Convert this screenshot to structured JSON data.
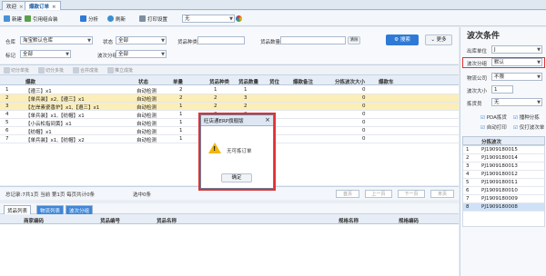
{
  "tabs": [
    {
      "label": "欢迎",
      "active": false
    },
    {
      "label": "爆款订单",
      "active": true
    }
  ],
  "toolbar": {
    "new": "新建",
    "fetch": "引用组合装",
    "analyze": "分析",
    "refresh": "刷新",
    "print_settings": "打印设置",
    "print_select": "无"
  },
  "filter": {
    "warehouse_label": "仓库",
    "warehouse_value": "淘宝默认仓库",
    "status_label": "状态",
    "status_value": "全部",
    "goods_kind_label": "货品种类",
    "goods_count_label": "货品数量",
    "goods_count_btn": "清除",
    "query_btn": "搜索",
    "more_btn": "更多",
    "mark_label": "标记",
    "mark_value": "全部",
    "wave_group_label": "波次分组",
    "wave_group_value": "全部"
  },
  "actions": [
    "切分单批",
    "切分多批",
    "合并成批",
    "推立成批"
  ],
  "grid": {
    "headers": [
      "",
      "爆款",
      "状态",
      "单量",
      "货品种类",
      "货品数量",
      "货位",
      "爆款备注",
      "分拣波次大小",
      "爆款车"
    ],
    "rows": [
      {
        "no": "1",
        "name": "【遵三】x1",
        "status": "自动检测",
        "qty": "2",
        "kinds": "1",
        "count": "1",
        "wave": "0",
        "hl": false
      },
      {
        "no": "2",
        "name": "【单兵装】x2,【遵三】x1",
        "status": "自动检测",
        "qty": "2",
        "kinds": "2",
        "count": "3",
        "wave": "0",
        "hl": true
      },
      {
        "no": "3",
        "name": "【左岸素瓷香炉】x1,【遵三】x1",
        "status": "自动检测",
        "qty": "1",
        "kinds": "2",
        "count": "2",
        "wave": "0",
        "hl": true
      },
      {
        "no": "4",
        "name": "【单兵装】x1,【纺帽】x1",
        "status": "自动检测",
        "qty": "1",
        "kinds": "2",
        "count": "2",
        "wave": "0",
        "hl": false
      },
      {
        "no": "5",
        "name": "【小云松指间黄】x1",
        "status": "自动检测",
        "qty": "1",
        "kinds": "1",
        "count": "1",
        "wave": "0",
        "hl": false
      },
      {
        "no": "6",
        "name": "【纺帽】x1",
        "status": "自动检测",
        "qty": "1",
        "kinds": "1",
        "count": "1",
        "wave": "0",
        "hl": false
      },
      {
        "no": "7",
        "name": "【单兵装】x1,【纺帽】x2",
        "status": "自动检测",
        "qty": "1",
        "kinds": "2",
        "count": "3",
        "wave": "0",
        "hl": false
      }
    ]
  },
  "status": {
    "summary": "总记录:7共1页 当前 第1页 每页共计0条",
    "selected": "选中0条",
    "pager": [
      "首页",
      "上一页",
      "下一页",
      "末页"
    ]
  },
  "bottom_tabs": [
    "货品列表",
    "物流列表",
    "波次分组"
  ],
  "bottom_grid": {
    "headers": [
      "商家编码",
      "货品编号",
      "货品名称",
      "规格名称",
      "规格编码"
    ]
  },
  "dialog": {
    "title": "旺店通ERP旗舰版",
    "message": "无可拣订单",
    "ok": "确定"
  },
  "right": {
    "title": "波次条件",
    "outbound_label": "出库单位",
    "outbound_value": "J",
    "wave_group_label": "波次分组",
    "wave_group_value": "默认",
    "logistics_label": "物流公司",
    "logistics_value": "不限",
    "wave_size_label": "波次大小",
    "wave_size_value": "1",
    "picker_label": "拣货员",
    "picker_value": "无",
    "checks": [
      {
        "label": "PDA拣货",
        "checked": true
      },
      {
        "label": "播种分拣",
        "checked": true
      },
      {
        "label": "自动打印",
        "checked": true
      },
      {
        "label": "仅打波次单",
        "checked": true
      }
    ],
    "list_header": "分拣波次",
    "list": [
      "PJ1909180015",
      "PJ1909180014",
      "PJ1909180013",
      "PJ1909180012",
      "PJ1909180011",
      "PJ1909180010",
      "PJ1909180009",
      "PJ1909180008"
    ],
    "list_nos": [
      "1",
      "2",
      "3",
      "4",
      "5",
      "6",
      "7",
      "8"
    ]
  }
}
